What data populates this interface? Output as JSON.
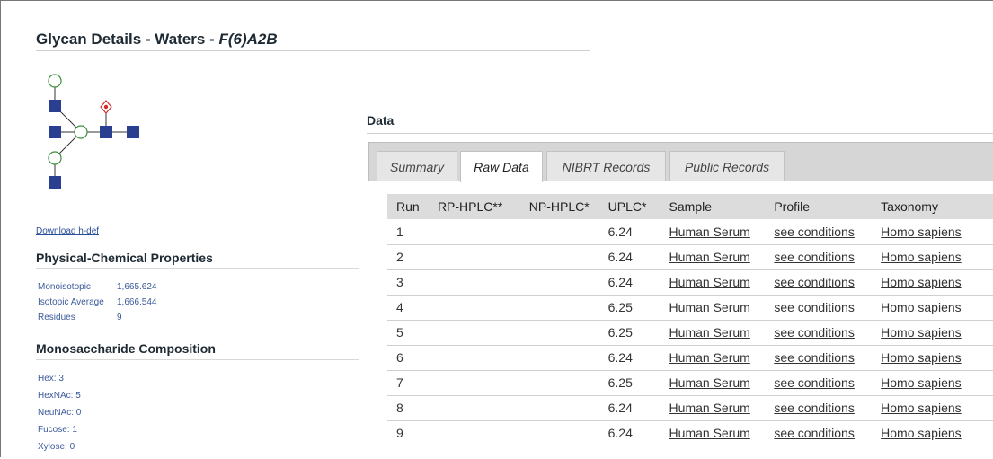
{
  "page": {
    "title_prefix": "Glycan Details - Waters - ",
    "title_glycan": "F(6)A2B",
    "download_label": "Download h-def"
  },
  "physchem": {
    "heading": "Physical-Chemical Properties",
    "rows": [
      {
        "label": "Monoisotopic",
        "value": "1,665.624"
      },
      {
        "label": "Isotopic Average",
        "value": "1,666.544"
      },
      {
        "label": "Residues",
        "value": "9"
      }
    ]
  },
  "composition": {
    "heading": "Monosaccharide Composition",
    "items": [
      "Hex: 3",
      "HexNAc: 5",
      "NeuNAc: 0",
      "Fucose: 1",
      "Xylose: 0"
    ]
  },
  "data_section": {
    "heading": "Data",
    "tabs": [
      {
        "label": "Summary",
        "active": false
      },
      {
        "label": "Raw Data",
        "active": true
      },
      {
        "label": "NIBRT Records",
        "active": false
      },
      {
        "label": "Public Records",
        "active": false
      }
    ]
  },
  "table": {
    "headers": [
      "Run",
      "RP-HPLC**",
      "NP-HPLC*",
      "UPLC*",
      "Sample",
      "Profile",
      "Taxonomy"
    ],
    "rows": [
      {
        "run": "1",
        "rp": "",
        "np": "",
        "uplc": "6.24",
        "sample": "Human Serum",
        "profile": "see conditions",
        "taxonomy": "Homo sapiens"
      },
      {
        "run": "2",
        "rp": "",
        "np": "",
        "uplc": "6.24",
        "sample": "Human Serum",
        "profile": "see conditions",
        "taxonomy": "Homo sapiens"
      },
      {
        "run": "3",
        "rp": "",
        "np": "",
        "uplc": "6.24",
        "sample": "Human Serum",
        "profile": "see conditions",
        "taxonomy": "Homo sapiens"
      },
      {
        "run": "4",
        "rp": "",
        "np": "",
        "uplc": "6.25",
        "sample": "Human Serum",
        "profile": "see conditions",
        "taxonomy": "Homo sapiens"
      },
      {
        "run": "5",
        "rp": "",
        "np": "",
        "uplc": "6.25",
        "sample": "Human Serum",
        "profile": "see conditions",
        "taxonomy": "Homo sapiens"
      },
      {
        "run": "6",
        "rp": "",
        "np": "",
        "uplc": "6.24",
        "sample": "Human Serum",
        "profile": "see conditions",
        "taxonomy": "Homo sapiens"
      },
      {
        "run": "7",
        "rp": "",
        "np": "",
        "uplc": "6.25",
        "sample": "Human Serum",
        "profile": "see conditions",
        "taxonomy": "Homo sapiens"
      },
      {
        "run": "8",
        "rp": "",
        "np": "",
        "uplc": "6.24",
        "sample": "Human Serum",
        "profile": "see conditions",
        "taxonomy": "Homo sapiens"
      },
      {
        "run": "9",
        "rp": "",
        "np": "",
        "uplc": "6.24",
        "sample": "Human Serum",
        "profile": "see conditions",
        "taxonomy": "Homo sapiens"
      }
    ]
  },
  "colors": {
    "glcnac": "#2a3f8f",
    "mannose_outline": "#3f8f3f",
    "fucose": "#d02a2a",
    "link": "#2a4e9a"
  }
}
